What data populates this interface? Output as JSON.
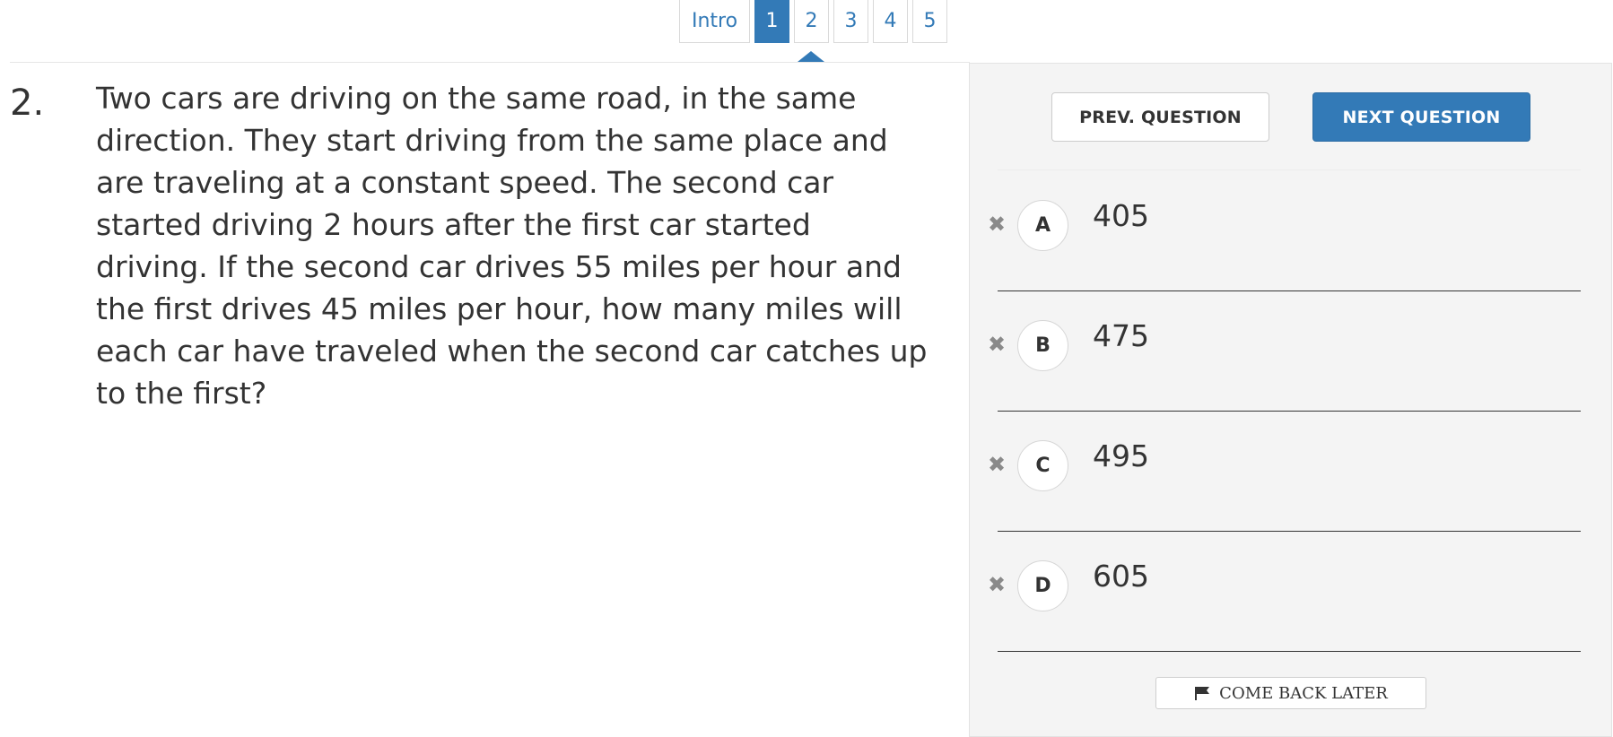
{
  "pager": {
    "items": [
      {
        "label": "Intro"
      },
      {
        "label": "1"
      },
      {
        "label": "2"
      },
      {
        "label": "3"
      },
      {
        "label": "4"
      },
      {
        "label": "5"
      }
    ],
    "active_label": "1"
  },
  "question": {
    "number": "2.",
    "text": "Two cars are driving on the same road, in the same direction. They start driving from the same place and are traveling at a constant speed. The second car started driving 2 hours after the first car started driving. If the second car drives 55 miles per hour and the first drives 45 miles per hour, how many miles will each car have traveled when the second car catches up to the first?"
  },
  "nav": {
    "prev_label": "PREV. QUESTION",
    "next_label": "NEXT QUESTION"
  },
  "choices": [
    {
      "letter": "A",
      "value": "405"
    },
    {
      "letter": "B",
      "value": "475"
    },
    {
      "letter": "C",
      "value": "495"
    },
    {
      "letter": "D",
      "value": "605"
    }
  ],
  "come_back_later": {
    "label": "COME BACK LATER",
    "icon": "flag-icon"
  },
  "colors": {
    "accent": "#337ab7",
    "panel_bg": "#f4f4f4"
  },
  "eliminate_icon": "close-icon"
}
